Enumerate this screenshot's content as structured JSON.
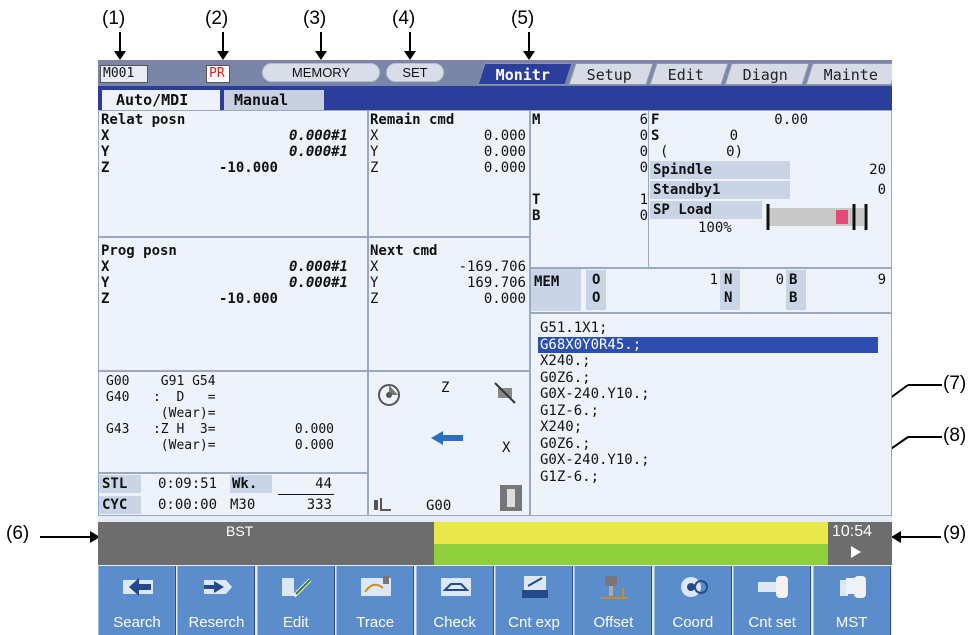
{
  "callouts": [
    "(1)",
    "(2)",
    "(3)",
    "(4)",
    "(5)",
    "(6)",
    "(7)",
    "(8)",
    "(9)"
  ],
  "header": {
    "machine": "M001",
    "pr": "PR",
    "mode": "MEMORY",
    "set": "SET",
    "tabs": [
      "Monitr",
      "Setup",
      "Edit",
      "Diagn",
      "Mainte"
    ]
  },
  "subtabs": [
    "Auto/MDI",
    "Manual"
  ],
  "relat": {
    "title": "Relat posn",
    "rows": [
      [
        "X",
        "0.000#1"
      ],
      [
        "Y",
        "0.000#1"
      ],
      [
        "Z",
        "-10.000"
      ]
    ]
  },
  "remain": {
    "title": "Remain cmd",
    "rows": [
      [
        "X",
        "0.000"
      ],
      [
        "Y",
        "0.000"
      ],
      [
        "Z",
        "0.000"
      ]
    ]
  },
  "prog": {
    "title": "Prog posn",
    "rows": [
      [
        "X",
        "0.000#1"
      ],
      [
        "Y",
        "0.000#1"
      ],
      [
        "Z",
        "-10.000"
      ]
    ]
  },
  "next": {
    "title": "Next cmd",
    "rows": [
      [
        "X",
        "-169.706"
      ],
      [
        "Y",
        "169.706"
      ],
      [
        "Z",
        "0.000"
      ]
    ]
  },
  "modal": {
    "line1": "G00    G91 G54",
    "line2": "G40   :  D   =",
    "line3": "       (Wear)=",
    "line4": "G43   :Z H  3=",
    "line4v": "0.000",
    "line5": "       (Wear)=",
    "line5v": "0.000"
  },
  "timers": {
    "stl": "STL",
    "stl_val": "0:09:51",
    "wk": "Wk.",
    "wk_val": "44",
    "cyc": "CYC",
    "cyc_val": "0:00:00",
    "m30": "M30",
    "m30_val": "333"
  },
  "graphic": {
    "z": "Z",
    "x": "X",
    "g": "G00"
  },
  "mst": {
    "m": "M",
    "m_vals": [
      "6",
      "0",
      "0",
      "0"
    ],
    "t": "T",
    "t_val": "1",
    "b": "B",
    "b_val": "0",
    "f": "F",
    "f_val": "0.00",
    "s": "S",
    "s_val": "0",
    "paren": "(",
    "paren_val": "0)",
    "spindle": "Spindle",
    "spindle_val": "20",
    "standby": "Standby1",
    "standby_val": "0",
    "spload": "SP Load",
    "spload_pct": "100%"
  },
  "mem": {
    "label": "MEM",
    "o": "O",
    "o_val": "1",
    "n": "N",
    "n_val": "0",
    "b": "B",
    "b_val": "9",
    "o2": "O",
    "n2": "N",
    "b2": "B"
  },
  "program": [
    "G51.1X1;",
    "G68X0Y0R45.;",
    "X240.;",
    "G0Z6.;",
    "G0X-240.Y10.;",
    "G1Z-6.;",
    "X240;",
    "G0Z6.;",
    "G0X-240.Y10.;",
    "G1Z-6.;"
  ],
  "status": {
    "bst": "BST",
    "clock": "10:54",
    "bar_yellow": "#e8e84a",
    "bar_green": "#8fcf3c"
  },
  "keys": [
    "Search",
    "Reserch",
    "Edit",
    "Trace",
    "Check",
    "Cnt exp",
    "Offset",
    "Coord",
    "Cnt set",
    "MST"
  ]
}
